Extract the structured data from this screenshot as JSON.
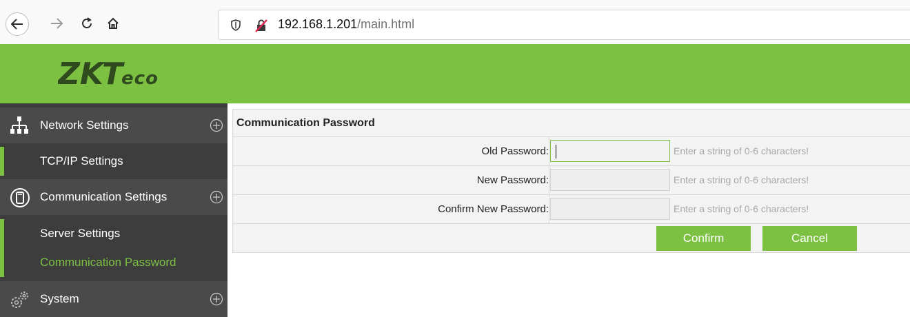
{
  "browser": {
    "url_host": "192.168.1.201",
    "url_path": "/main.html"
  },
  "header": {
    "logo_text": "ZKTeco"
  },
  "sidebar": {
    "sections": [
      {
        "label": "Network Settings",
        "icon": "network-icon"
      },
      {
        "label": "Communication Settings",
        "icon": "communication-icon"
      },
      {
        "label": "System",
        "icon": "gears-icon"
      }
    ],
    "items": [
      {
        "label": "TCP/IP Settings",
        "active": false
      },
      {
        "label": "Server Settings",
        "active": false
      },
      {
        "label": "Communication Password",
        "active": true
      }
    ]
  },
  "panel": {
    "title": "Communication Password",
    "fields": [
      {
        "label": "Old Password:",
        "value": "",
        "hint": "Enter a string of 0-6 characters!"
      },
      {
        "label": "New Password:",
        "value": "",
        "hint": "Enter a string of 0-6 characters!"
      },
      {
        "label": "Confirm New Password:",
        "value": "",
        "hint": "Enter a string of 0-6 characters!"
      }
    ],
    "confirm_label": "Confirm",
    "cancel_label": "Cancel"
  },
  "colors": {
    "brand": "#7dc143",
    "sidebar_bg": "#3d3d3d",
    "section_bg": "#4a4a4a"
  }
}
